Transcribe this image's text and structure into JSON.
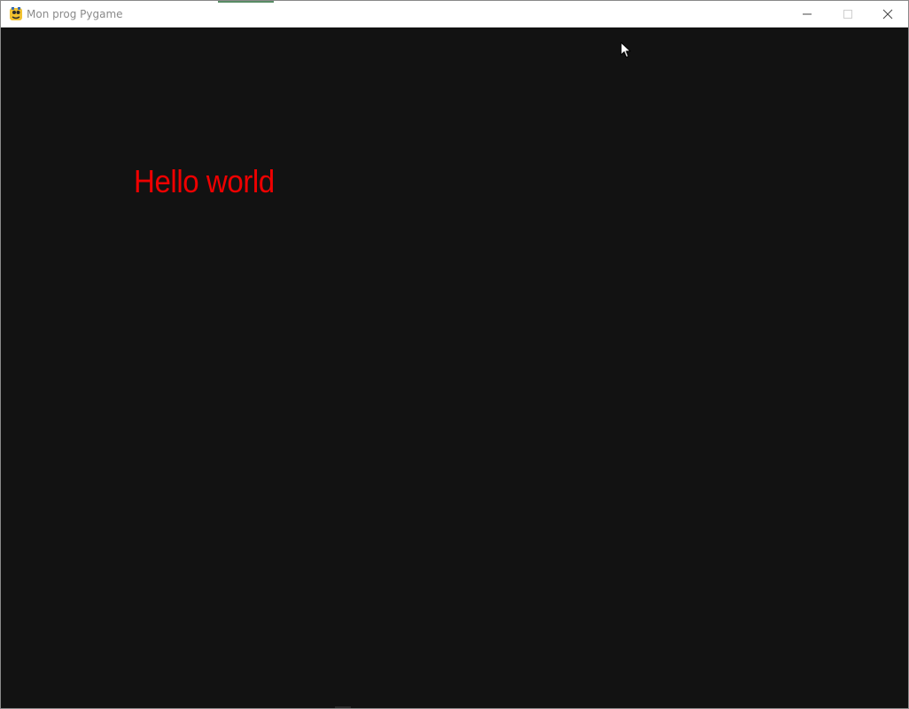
{
  "window": {
    "title": "Mon prog Pygame"
  },
  "titlebar": {
    "icons": {
      "app": "pygame-snake-icon",
      "minimize": "minimize-icon",
      "maximize": "maximize-icon",
      "close": "close-icon"
    }
  },
  "canvas": {
    "background_color": "#121212",
    "text": "Hello world",
    "text_color": "#ee0000"
  },
  "cursor": {
    "icon": "mouse-pointer-icon"
  }
}
